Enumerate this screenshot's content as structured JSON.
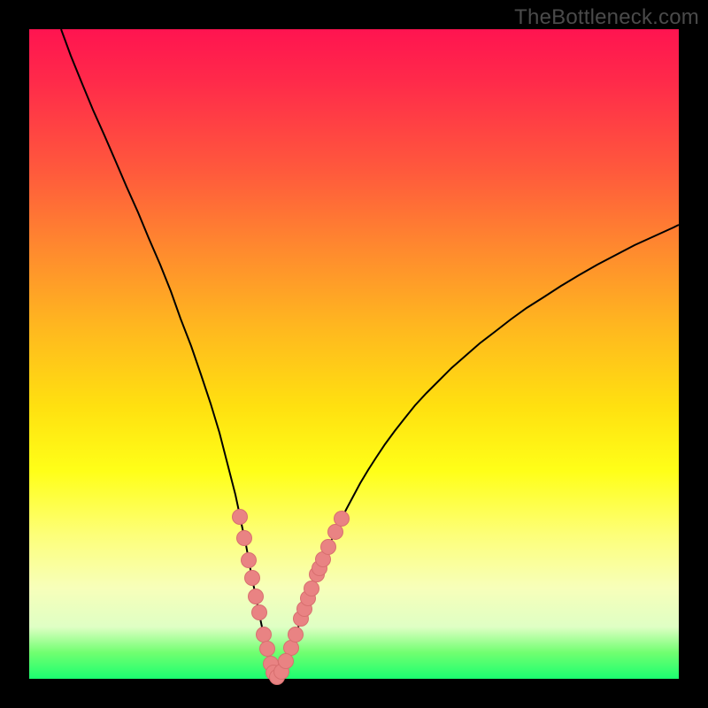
{
  "attribution": "TheBottleneck.com",
  "chart_data": {
    "type": "line",
    "title": "",
    "xlabel": "",
    "ylabel": "",
    "xlim": [
      0,
      100
    ],
    "ylim": [
      0,
      100
    ],
    "series": [
      {
        "name": "left_curve_polyline_px",
        "values": [
          [
            36,
            0
          ],
          [
            47,
            30
          ],
          [
            60,
            62
          ],
          [
            72,
            91
          ],
          [
            85,
            120
          ],
          [
            98,
            150
          ],
          [
            110,
            178
          ],
          [
            123,
            207
          ],
          [
            135,
            236
          ],
          [
            148,
            266
          ],
          [
            160,
            296
          ],
          [
            171,
            327
          ],
          [
            183,
            358
          ],
          [
            194,
            390
          ],
          [
            205,
            423
          ],
          [
            215,
            456
          ],
          [
            224,
            491
          ],
          [
            233,
            526
          ],
          [
            236,
            540
          ],
          [
            239,
            555
          ],
          [
            242,
            569
          ],
          [
            245,
            583
          ],
          [
            247,
            594
          ],
          [
            249,
            605
          ],
          [
            251,
            616
          ],
          [
            253,
            626
          ],
          [
            255,
            636
          ],
          [
            257,
            646
          ],
          [
            259,
            656
          ],
          [
            261,
            666
          ],
          [
            264,
            680
          ],
          [
            266,
            688
          ],
          [
            267,
            692
          ],
          [
            269,
            700
          ],
          [
            270,
            705
          ],
          [
            271,
            709
          ],
          [
            273,
            716
          ],
          [
            274,
            719
          ],
          [
            274,
            720
          ],
          [
            275,
            723
          ],
          [
            276,
            726
          ],
          [
            278,
            731
          ],
          [
            279,
            733
          ],
          [
            280,
            734
          ]
        ]
      },
      {
        "name": "right_curve_polyline_px",
        "values": [
          [
            280,
            734
          ],
          [
            281,
            733
          ],
          [
            282,
            731
          ],
          [
            284,
            728
          ],
          [
            286,
            724
          ],
          [
            288,
            719
          ],
          [
            290,
            714
          ],
          [
            293,
            707
          ],
          [
            296,
            699
          ],
          [
            299,
            690
          ],
          [
            302,
            681
          ],
          [
            306,
            670
          ],
          [
            310,
            658
          ],
          [
            313,
            649
          ],
          [
            316,
            641
          ],
          [
            320,
            630
          ],
          [
            324,
            619
          ],
          [
            328,
            609
          ],
          [
            333,
            597
          ],
          [
            338,
            585
          ],
          [
            344,
            572
          ],
          [
            351,
            557
          ],
          [
            358,
            543
          ],
          [
            366,
            528
          ],
          [
            374,
            513
          ],
          [
            383,
            498
          ],
          [
            392,
            484
          ],
          [
            402,
            469
          ],
          [
            413,
            454
          ],
          [
            424,
            440
          ],
          [
            436,
            425
          ],
          [
            449,
            411
          ],
          [
            463,
            397
          ],
          [
            477,
            383
          ],
          [
            493,
            369
          ],
          [
            509,
            355
          ],
          [
            526,
            342
          ],
          [
            544,
            328
          ],
          [
            562,
            315
          ],
          [
            581,
            303
          ],
          [
            601,
            290
          ],
          [
            621,
            278
          ],
          [
            642,
            266
          ],
          [
            663,
            255
          ],
          [
            684,
            244
          ],
          [
            706,
            234
          ],
          [
            728,
            224
          ],
          [
            734,
            221
          ]
        ]
      },
      {
        "name": "left_arm_markers_px",
        "values": [
          [
            238,
            551
          ],
          [
            243,
            575
          ],
          [
            248,
            600
          ],
          [
            252,
            620
          ],
          [
            256,
            641
          ],
          [
            260,
            659
          ],
          [
            265,
            684
          ],
          [
            269,
            700
          ]
        ]
      },
      {
        "name": "right_arm_markers_px",
        "values": [
          [
            296,
            699
          ],
          [
            301,
            684
          ],
          [
            307,
            666
          ],
          [
            311,
            655
          ],
          [
            315,
            643
          ],
          [
            319,
            632
          ],
          [
            325,
            616
          ],
          [
            328,
            609
          ],
          [
            332,
            599
          ],
          [
            338,
            585
          ],
          [
            346,
            568
          ],
          [
            353,
            553
          ]
        ]
      },
      {
        "name": "bottom_markers_px",
        "values": [
          [
            273,
            717
          ],
          [
            276,
            727
          ],
          [
            280,
            732
          ],
          [
            285,
            726
          ],
          [
            290,
            714
          ]
        ]
      }
    ],
    "colors": {
      "curve_stroke": "#000000",
      "marker_fill": "#e98383",
      "marker_stroke": "#d86f6f"
    }
  }
}
